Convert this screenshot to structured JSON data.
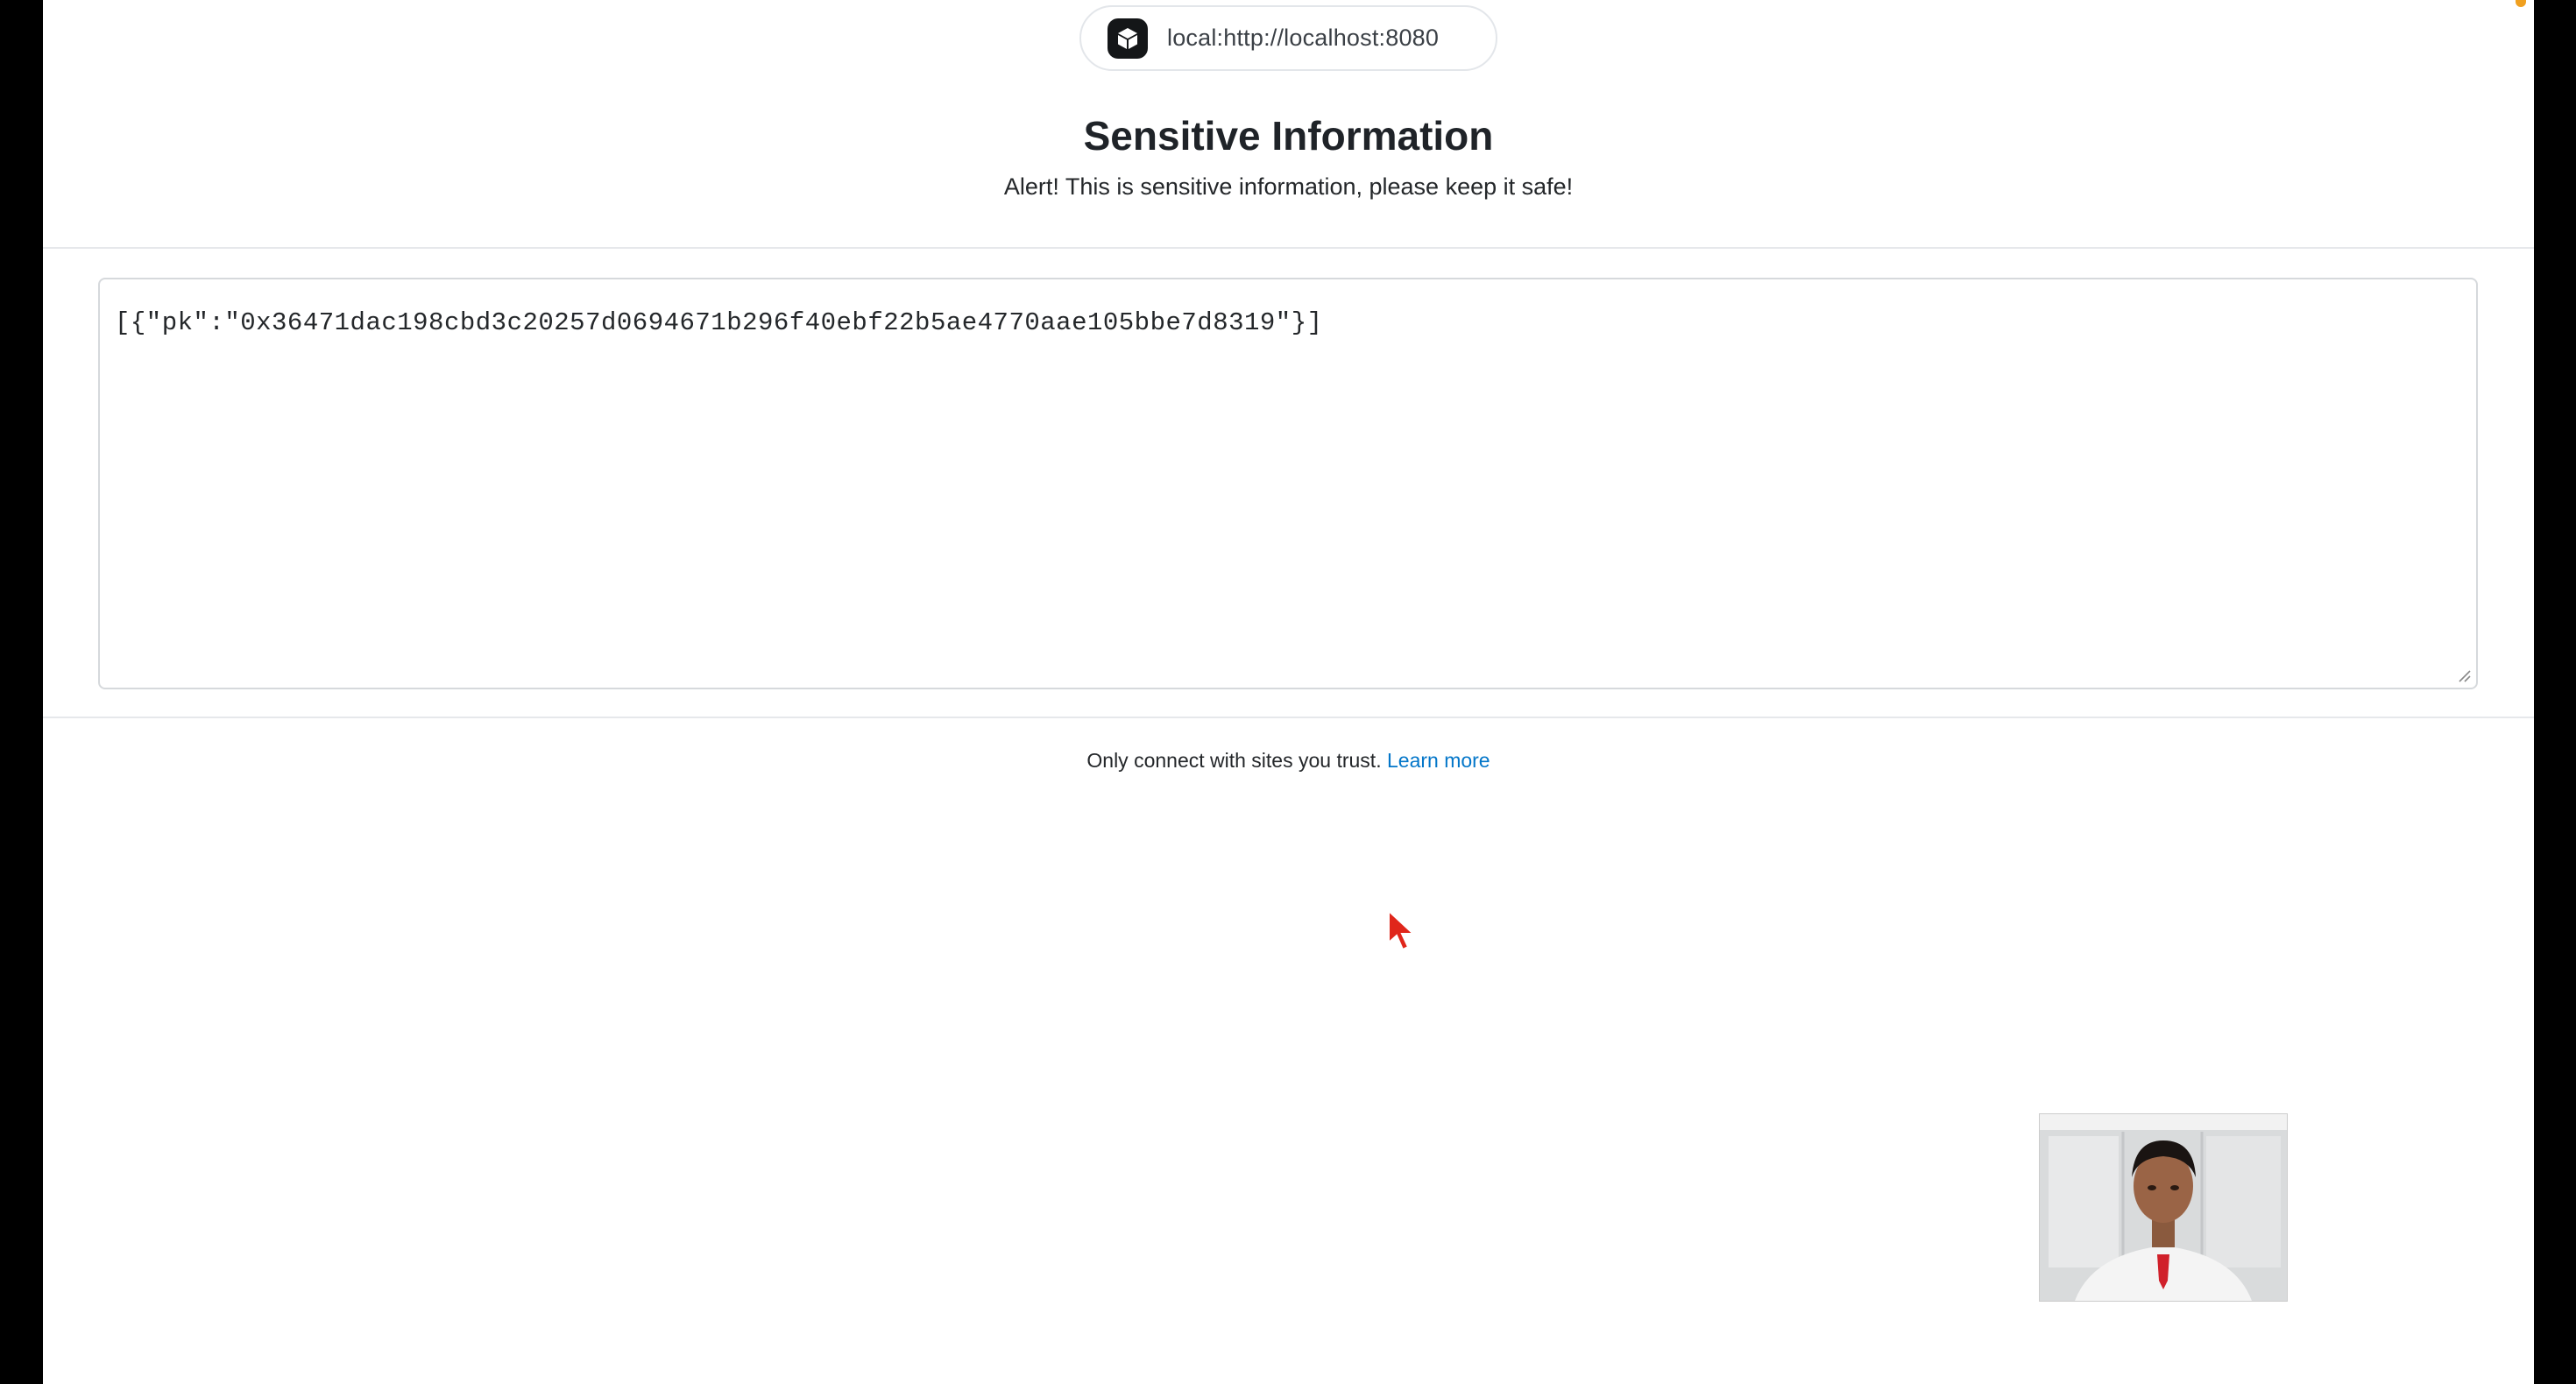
{
  "origin": {
    "url": "local:http://localhost:8080",
    "icon": "snap-box-icon"
  },
  "header": {
    "title": "Sensitive Information",
    "subtitle": "Alert! This is sensitive information, please keep it safe!"
  },
  "secret": {
    "value": "[{\"pk\":\"0x36471dac198cbd3c20257d0694671b296f40ebf22b5ae4770aae105bbe7d8319\"}]"
  },
  "footer": {
    "note": "Only connect with sites you trust.",
    "link_label": "Learn more"
  },
  "colors": {
    "link": "#0376c9",
    "cursor": "#e0261b",
    "status_dot": "#f0a020"
  }
}
